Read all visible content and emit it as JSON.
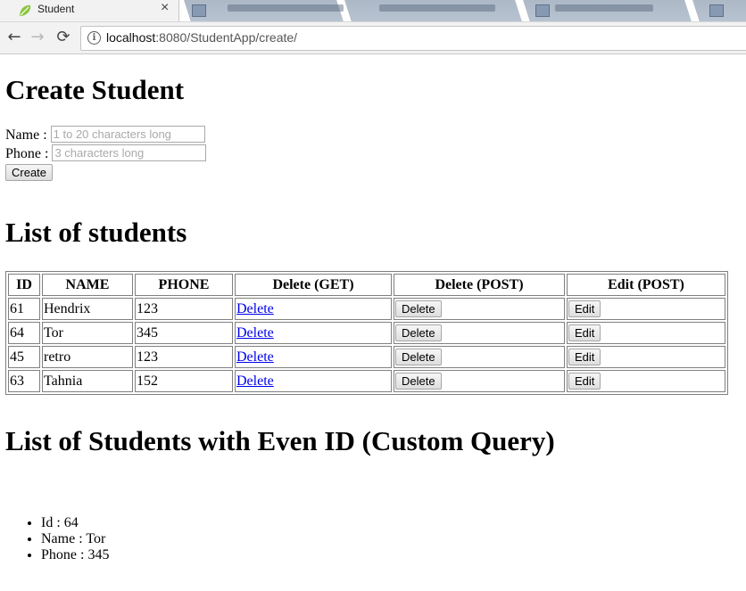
{
  "browser": {
    "tab_title": "Student",
    "tab_close": "×",
    "nav": {
      "back": "←",
      "forward": "→",
      "reload": "⟳"
    },
    "url_host": "localhost",
    "url_rest": ":8080/StudentApp/create/",
    "info_symbol": "i"
  },
  "create": {
    "heading": "Create Student",
    "name_label": "Name : ",
    "name_placeholder": "1 to 20 characters long",
    "phone_label": "Phone : ",
    "phone_placeholder": "3 characters long",
    "submit_label": "Create"
  },
  "list": {
    "heading": "List of students",
    "columns": [
      "ID",
      "NAME",
      "PHONE",
      "Delete (GET)",
      "Delete (POST)",
      "Edit (POST)"
    ],
    "rows": [
      {
        "id": "61",
        "name": "Hendrix",
        "phone": "123",
        "delete_link": "Delete",
        "delete_button": "Delete",
        "edit_button": "Edit"
      },
      {
        "id": "64",
        "name": "Tor",
        "phone": "345",
        "delete_link": "Delete",
        "delete_button": "Delete",
        "edit_button": "Edit"
      },
      {
        "id": "45",
        "name": "retro",
        "phone": "123",
        "delete_link": "Delete",
        "delete_button": "Delete",
        "edit_button": "Edit"
      },
      {
        "id": "63",
        "name": "Tahnia",
        "phone": "152",
        "delete_link": "Delete",
        "delete_button": "Delete",
        "edit_button": "Edit"
      }
    ]
  },
  "even": {
    "heading": "List of Students with Even ID (Custom Query)",
    "items": [
      "Id : 64",
      "Name : Tor",
      "Phone : 345"
    ]
  },
  "colors": {
    "link": "#0000ee",
    "tab_active_bg": "#f2f2f2",
    "favicon_green": "#8cc63f"
  },
  "icons": [
    "spring-leaf-icon",
    "close-icon",
    "back-arrow-icon",
    "forward-arrow-icon",
    "reload-icon",
    "info-icon"
  ]
}
